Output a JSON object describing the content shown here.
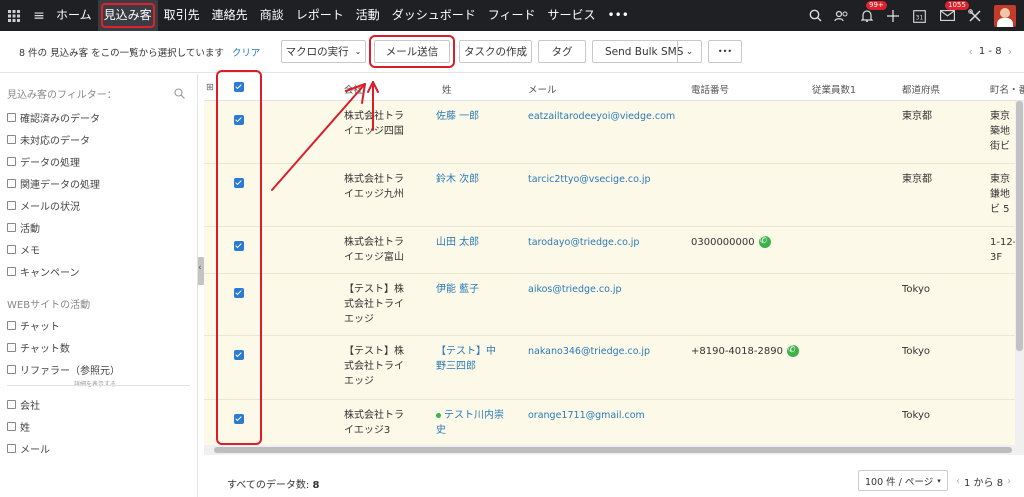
{
  "topnav": {
    "items": [
      "ホーム",
      "見込み客",
      "取引先",
      "連絡先",
      "商談",
      "レポート",
      "活動",
      "ダッシュボード",
      "フィード",
      "サービス",
      "•••"
    ],
    "active_index": 1,
    "notif_badge": "99+",
    "calendar_day": "31",
    "mail_badge": "1055",
    "accent_color": "#e0212b"
  },
  "toolbar": {
    "selection_text": "8 件の 見込み客 をこの一覧から選択しています",
    "clear_label": "クリア",
    "macro_label": "マクロの実行",
    "send_mail_label": "メール送信",
    "create_task_label": "タスクの作成",
    "tag_label": "タグ",
    "sms_label": "Send Bulk SMS",
    "more_label": "•••",
    "pager": "1 - 8"
  },
  "filters": {
    "title": "見込み客のフィルター：",
    "system_items": [
      "確認済みのデータ",
      "未対応のデータ",
      "データの処理",
      "関連データの処理",
      "メールの状況",
      "活動",
      "メモ",
      "キャンペーン"
    ],
    "web_section_title": "WEBサイトの活動",
    "web_items": [
      "チャット",
      "チャット数",
      "リファラー（参照元）"
    ],
    "more_label": "詳細を表示する",
    "field_items": [
      "会社",
      "姓",
      "メール"
    ]
  },
  "table": {
    "columns": [
      "会社",
      "姓",
      "メール",
      "電話番号",
      "従業員数1",
      "都道府県",
      "町名・番地"
    ],
    "rows": [
      {
        "company": [
          "株式会社トラ",
          "イエッジ四国"
        ],
        "name": [
          "佐藤 一郎"
        ],
        "email": "eatzailtarodeeyoi@viedge.com",
        "phone": "",
        "pref": "東京都",
        "town": [
          "東京",
          "築地",
          "街ビ"
        ]
      },
      {
        "company": [
          "株式会社トラ",
          "イエッジ九州"
        ],
        "name": [
          "鈴木 次郎"
        ],
        "email": "tarcic2ttyo@vsecige.co.jp",
        "phone": "",
        "pref": "東京都",
        "town": [
          "東京",
          "鎌地",
          "ビ 5"
        ]
      },
      {
        "company": [
          "株式会社トラ",
          "イエッジ富山"
        ],
        "name": [
          "山田 太郎"
        ],
        "email": "tarodayo@triedge.co.jp",
        "phone": "0300000000",
        "pref": "",
        "town": [
          "1-12-",
          "3F"
        ]
      },
      {
        "company": [
          "【テスト】株",
          "式会社トライ",
          "エッジ"
        ],
        "name": [
          "伊能 藍子"
        ],
        "email": "aikos@triedge.co.jp",
        "phone": "",
        "pref": "Tokyo",
        "town": []
      },
      {
        "company": [
          "【テスト】株",
          "式会社トライ",
          "エッジ"
        ],
        "name": [
          "【テスト】中",
          "野三四郎"
        ],
        "email": "nakano346@triedge.co.jp",
        "phone": "+8190-4018-2890",
        "pref": "Tokyo",
        "town": []
      },
      {
        "company": [
          "株式会社トラ",
          "イエッジ3"
        ],
        "name": [
          "テスト川内崇",
          "史"
        ],
        "email": "orange1711@gmail.com",
        "phone": "",
        "pref": "Tokyo",
        "town": []
      }
    ]
  },
  "footer": {
    "total_label": "すべてのデータ数:",
    "total_value": "8",
    "per_page": "100 件 / ページ",
    "pager": "1 から 8"
  }
}
